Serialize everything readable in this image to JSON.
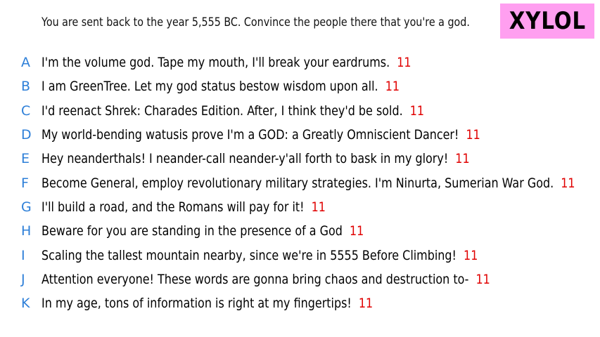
{
  "prompt": "You are sent back to the year 5,555 BC. Convince the people there that you're a god.",
  "logo": "XYLOL",
  "colors": {
    "logo_bg": "#ff9ff0",
    "letter": "#2d7fd8",
    "score": "#e00000"
  },
  "answers": [
    {
      "letter": "A",
      "text": "I'm the volume god. Tape my mouth, I'll break your eardrums.",
      "score": "11"
    },
    {
      "letter": "B",
      "text": "I am GreenTree. Let my god status bestow wisdom upon all.",
      "score": "11"
    },
    {
      "letter": "C",
      "text": "I'd reenact Shrek: Charades Edition. After, I think they'd be sold.",
      "score": "11"
    },
    {
      "letter": "D",
      "text": "My world-bending watusis prove I'm a GOD: a Greatly Omniscient Dancer!",
      "score": "11"
    },
    {
      "letter": "E",
      "text": "Hey neanderthals! I neander-call neander-y'all forth to bask in my glory!",
      "score": "11"
    },
    {
      "letter": "F",
      "text": "Become General, employ revolutionary military strategies. I'm Ninurta, Sumerian War God.",
      "score": "11"
    },
    {
      "letter": "G",
      "text": "I'll build a road, and the Romans will pay for it!",
      "score": "11"
    },
    {
      "letter": "H",
      "text": "Beware for you are standing in the presence of a God",
      "score": "11"
    },
    {
      "letter": "I",
      "text": "Scaling the tallest mountain nearby, since we're in 5555 Before Climbing!",
      "score": "11"
    },
    {
      "letter": "J",
      "text": "Attention everyone! These words are gonna bring chaos and destruction to-",
      "score": "11"
    },
    {
      "letter": "K",
      "text": "In my age, tons of information is right at my fingertips!",
      "score": "11"
    }
  ]
}
